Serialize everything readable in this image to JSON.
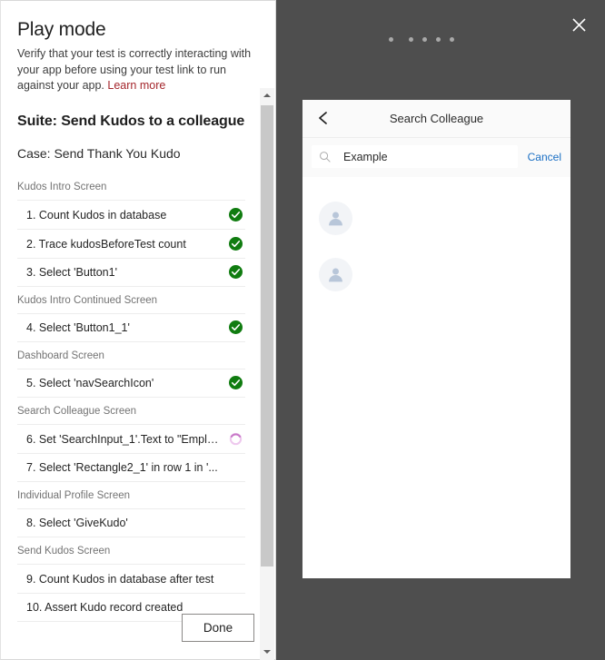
{
  "colors": {
    "accent_link": "#a4262c",
    "success_green": "#107c10",
    "spinner_pink": "#c878c8",
    "cancel_blue": "#1a6fc4",
    "backdrop_gray": "#4e4e4e"
  },
  "left_panel": {
    "title": "Play mode",
    "description": "Verify that your test is correctly interacting with your app before using your test link to run against your app.",
    "learn_more_label": "Learn more",
    "suite_title": "Suite: Send Kudos to a colleague",
    "case_title": "Case: Send Thank You Kudo",
    "done_label": "Done",
    "groups": [
      {
        "screen": "Kudos Intro Screen",
        "steps": [
          {
            "text": "1. Count Kudos in database",
            "status": "passed"
          },
          {
            "text": "2. Trace kudosBeforeTest count",
            "status": "passed"
          },
          {
            "text": "3. Select 'Button1'",
            "status": "passed"
          }
        ]
      },
      {
        "screen": "Kudos Intro Continued Screen",
        "steps": [
          {
            "text": "4. Select 'Button1_1'",
            "status": "passed"
          }
        ]
      },
      {
        "screen": "Dashboard Screen",
        "steps": [
          {
            "text": "5. Select 'navSearchIcon'",
            "status": "passed"
          }
        ]
      },
      {
        "screen": "Search Colleague Screen",
        "steps": [
          {
            "text": "6. Set 'SearchInput_1'.Text to \"Emplo...",
            "status": "running"
          },
          {
            "text": "7. Select 'Rectangle2_1' in row 1 in '...",
            "status": "none"
          }
        ]
      },
      {
        "screen": "Individual Profile Screen",
        "steps": [
          {
            "text": "8. Select 'GiveKudo'",
            "status": "none"
          }
        ]
      },
      {
        "screen": "Send Kudos Screen",
        "steps": [
          {
            "text": "9. Count Kudos in database after test",
            "status": "none"
          },
          {
            "text": "10. Assert Kudo record created",
            "status": "none"
          }
        ]
      }
    ]
  },
  "player": {
    "close_label": "Close",
    "dots_count": 5,
    "phone": {
      "back_label": "Back",
      "title": "Search Colleague",
      "search_value": "Example",
      "search_placeholder": "Search",
      "cancel_label": "Cancel",
      "results": [
        {
          "name": ""
        },
        {
          "name": ""
        }
      ]
    }
  }
}
